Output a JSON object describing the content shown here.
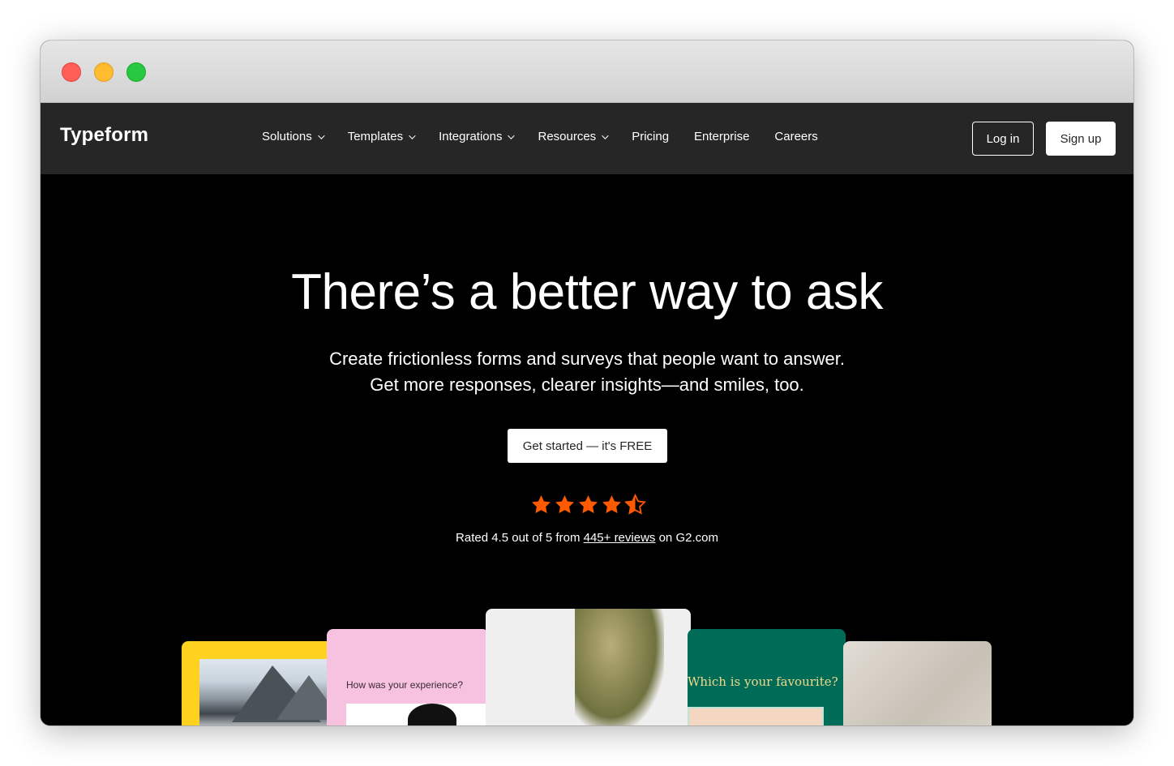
{
  "nav": {
    "logo": "Typeform",
    "items": [
      {
        "label": "Solutions",
        "dropdown": true
      },
      {
        "label": "Templates",
        "dropdown": true
      },
      {
        "label": "Integrations",
        "dropdown": true
      },
      {
        "label": "Resources",
        "dropdown": true
      },
      {
        "label": "Pricing",
        "dropdown": false
      },
      {
        "label": "Enterprise",
        "dropdown": false
      },
      {
        "label": "Careers",
        "dropdown": false
      }
    ],
    "login": "Log in",
    "signup": "Sign up"
  },
  "hero": {
    "headline": "There’s a better way to ask",
    "sub_line1": "Create frictionless forms and surveys that people want to answer.",
    "sub_line2": "Get more responses, clearer insights—and smiles, too.",
    "cta": "Get started — it's FREE",
    "rating_prefix": "Rated 4.5 out of 5 from",
    "rating_link": "445+ reviews",
    "rating_suffix": "on G2.com",
    "rating_value": 4.5,
    "star_color": "#ff5a00"
  },
  "cards": {
    "card2_question": "How was your experience?",
    "card4_question": "Which is your favourite?"
  },
  "colors": {
    "nav_bg": "#262626",
    "hero_bg": "#000000",
    "card_yellow": "#ffd21f",
    "card_pink": "#f7c2df",
    "card_green": "#006b57"
  }
}
